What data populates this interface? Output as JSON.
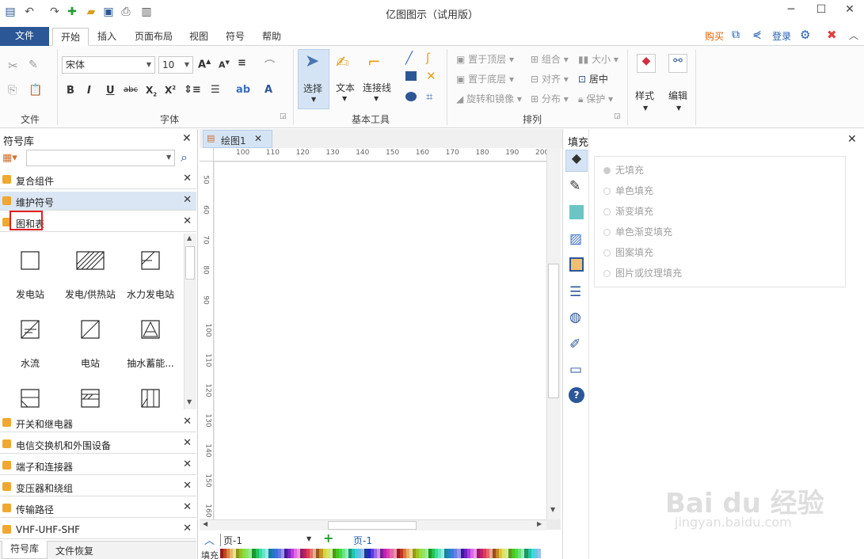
{
  "app_title": "亿图图示（试用版）",
  "tabs": [
    "文件",
    "开始",
    "插入",
    "页面布局",
    "视图",
    "符号",
    "帮助"
  ],
  "header_right": {
    "buy": "购买",
    "login": "登录"
  },
  "ribbon": {
    "groups": {
      "file": "文件",
      "font": "字体",
      "basic_tools": "基本工具",
      "arrange": "排列"
    },
    "font_name": "宋体",
    "font_size": "10",
    "tools": {
      "select": "选择",
      "text": "文本",
      "connector": "连接线"
    },
    "arrange": {
      "bring_front": "置于顶层",
      "send_back": "置于底层",
      "rotate": "旋转和镜像",
      "group": "组合",
      "align": "对齐",
      "distribute": "分布",
      "size": "大小",
      "center": "居中",
      "protect": "保护"
    },
    "style": "样式",
    "edit": "编辑"
  },
  "left_panel": {
    "title": "符号库",
    "search_placeholder": "",
    "libraries_top": [
      "复合组件",
      "维护符号",
      "图和表"
    ],
    "shapes": [
      "发电站",
      "发电/供热站",
      "水力发电站",
      "水流",
      "电站",
      "抽水蓄能..."
    ],
    "libraries_bottom": [
      "开关和继电器",
      "电信交换机和外围设备",
      "端子和连接器",
      "变压器和绕组",
      "传输路径",
      "VHF-UHF-SHF"
    ],
    "bottom_tabs": [
      "符号库",
      "文件恢复"
    ]
  },
  "document": {
    "tab_name": "绘图1",
    "h_ruler": [
      "100",
      "110",
      "120",
      "130",
      "140",
      "150",
      "160",
      "170",
      "180",
      "190",
      "200"
    ],
    "v_ruler": [
      "50",
      "60",
      "70",
      "80",
      "90",
      "100",
      "110",
      "120",
      "130",
      "140",
      "150",
      "160"
    ],
    "page_select": "页-1",
    "page_tab": "页-1",
    "fill_label": "填充"
  },
  "fill_panel": {
    "title": "填充",
    "options": [
      "无填充",
      "单色填充",
      "渐变填充",
      "单色渐变填充",
      "图案填充",
      "图片或纹理填充"
    ]
  },
  "colors": {
    "file_tab": "#2b5797",
    "star": "#f0a830",
    "accent_blue": "#1f5fb0"
  }
}
